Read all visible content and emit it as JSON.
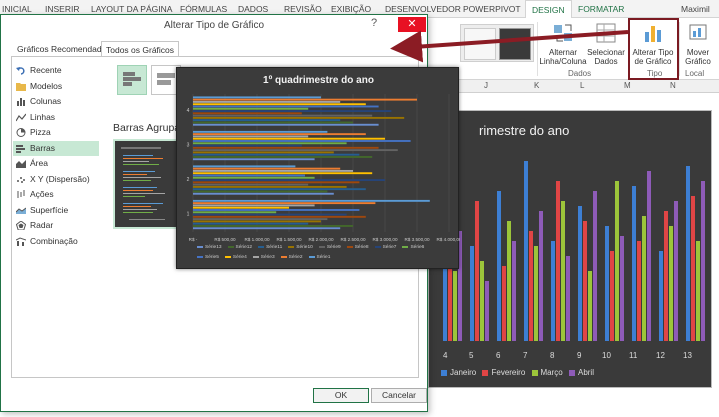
{
  "ribbon": {
    "tabs": [
      {
        "label": "INICIAL"
      },
      {
        "label": "INSERIR"
      },
      {
        "label": "LAYOUT DA PÁGINA"
      },
      {
        "label": "FÓRMULAS"
      },
      {
        "label": "DADOS"
      },
      {
        "label": "REVISÃO"
      },
      {
        "label": "EXIBIÇÃO"
      },
      {
        "label": "DESENVOLVEDOR"
      },
      {
        "label": "POWERPIVOT"
      },
      {
        "label": "DESIGN"
      },
      {
        "label": "FORMATAR"
      }
    ],
    "user": "Maximil",
    "buttons": {
      "switch_row_col_1": "Alternar",
      "switch_row_col_2": "Linha/Coluna",
      "select_data_1": "Selecionar",
      "select_data_2": "Dados",
      "change_type_1": "Alterar Tipo",
      "change_type_2": "de Gráfico",
      "move_chart_1": "Mover",
      "move_chart_2": "Gráfico"
    },
    "groups": {
      "dados": "Dados",
      "tipo": "Tipo",
      "local": "Local"
    }
  },
  "sheet": {
    "columns": [
      "J",
      "K",
      "L",
      "M",
      "N"
    ],
    "bg_chart_title": "rimestre do ano",
    "x_labels": [
      "4",
      "5",
      "6",
      "7",
      "8",
      "9",
      "10",
      "11",
      "12",
      "13"
    ],
    "legend": [
      "Janeiro",
      "Fevereiro",
      "Março",
      "Abril"
    ],
    "legend_colors": [
      "#3d7fd4",
      "#e04545",
      "#9cc53a",
      "#8e5bb8"
    ]
  },
  "dialog": {
    "title": "Alterar Tipo de Gráfico",
    "help": "?",
    "close": "✕",
    "tabs": [
      "Gráficos Recomendados",
      "Todos os Gráficos"
    ],
    "chart_types": [
      {
        "label": "Recente",
        "icon": "undo-icon"
      },
      {
        "label": "Modelos",
        "icon": "folder-icon"
      },
      {
        "label": "Colunas",
        "icon": "column-chart-icon"
      },
      {
        "label": "Linhas",
        "icon": "line-chart-icon"
      },
      {
        "label": "Pizza",
        "icon": "pie-chart-icon"
      },
      {
        "label": "Barras",
        "icon": "bar-chart-icon"
      },
      {
        "label": "Área",
        "icon": "area-chart-icon"
      },
      {
        "label": "X Y (Dispersão)",
        "icon": "scatter-chart-icon"
      },
      {
        "label": "Ações",
        "icon": "stock-chart-icon"
      },
      {
        "label": "Superfície",
        "icon": "surface-chart-icon"
      },
      {
        "label": "Radar",
        "icon": "radar-chart-icon"
      },
      {
        "label": "Combinação",
        "icon": "combo-chart-icon"
      }
    ],
    "selected_type": "Barras",
    "subtype_label": "Barras Agrupad",
    "ok": "OK",
    "cancel": "Cancelar"
  },
  "chart_data": {
    "type": "bar",
    "title": "1º quadrimestre do ano",
    "categories": [
      "1",
      "2",
      "3",
      "4"
    ],
    "x_tick_labels": [
      "R$ -",
      "R$ 500,00",
      "R$ 1.000,00",
      "R$ 1.500,00",
      "R$ 2.000,00",
      "R$ 2.500,00",
      "R$ 3.000,00",
      "R$ 3.500,00",
      "R$ 4.000,00"
    ],
    "xlim": [
      0,
      4000
    ],
    "series": [
      {
        "name": "Série1",
        "color": "#5b9bd5",
        "values": [
          3700,
          1600,
          2100,
          2000
        ]
      },
      {
        "name": "Série2",
        "color": "#ed7d31",
        "values": [
          2850,
          2300,
          2700,
          3500
        ]
      },
      {
        "name": "Série3",
        "color": "#a5a5a5",
        "values": [
          1900,
          2500,
          1800,
          2300
        ]
      },
      {
        "name": "Série4",
        "color": "#ffc000",
        "values": [
          1500,
          2800,
          3000,
          2700
        ]
      },
      {
        "name": "Série5",
        "color": "#4472c4",
        "values": [
          2600,
          1750,
          3400,
          2900
        ]
      },
      {
        "name": "Série6",
        "color": "#70ad47",
        "values": [
          1300,
          1900,
          2400,
          1800
        ]
      },
      {
        "name": "Série7",
        "color": "#264478",
        "values": [
          2400,
          3000,
          1700,
          3100
        ]
      },
      {
        "name": "Série8",
        "color": "#9e480e",
        "values": [
          2700,
          2600,
          2900,
          1700
        ]
      },
      {
        "name": "Série9",
        "color": "#636363",
        "values": [
          2100,
          1800,
          3200,
          2800
        ]
      },
      {
        "name": "Série10",
        "color": "#997300",
        "values": [
          2000,
          2400,
          2200,
          3300
        ]
      },
      {
        "name": "Série11",
        "color": "#255e91",
        "values": [
          1800,
          2700,
          2600,
          2300
        ]
      },
      {
        "name": "Série12",
        "color": "#43682b",
        "values": [
          2500,
          2100,
          2800,
          2500
        ]
      },
      {
        "name": "Série13",
        "color": "#698ed0",
        "values": [
          2300,
          2200,
          1900,
          2900
        ]
      }
    ],
    "legend_order": [
      "Série13",
      "Série12",
      "Série11",
      "Série10",
      "Série9",
      "Série8",
      "Série7",
      "Série6",
      "Série5",
      "Série4",
      "Série3",
      "Série2",
      "Série1"
    ],
    "legend_position": "bottom",
    "grid": true
  }
}
